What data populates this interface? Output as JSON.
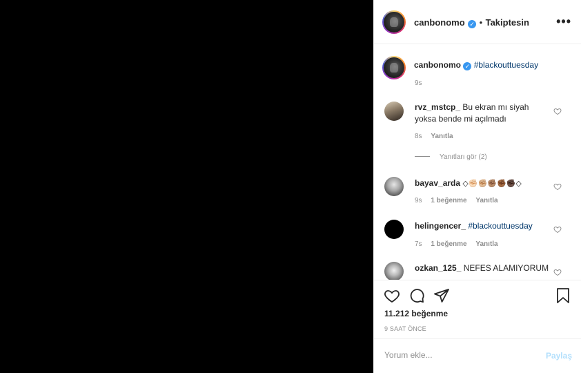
{
  "post": {
    "username": "canbonomo",
    "follow_separator": "•",
    "follow_label": "Takiptesin",
    "more_icon": "more-options-icon"
  },
  "caption": {
    "username": "canbonomo",
    "text": "#blackouttuesday",
    "time": "9s"
  },
  "comments": [
    {
      "username": "rvz_mstcp_",
      "text_line1": "Bu ekran mı siyah",
      "text_line2": "yoksa bende mi açılmadı",
      "time": "8s",
      "reply_label": "Yanıtla",
      "view_replies": "Yanıtları gör (2)"
    },
    {
      "username": "bayav_arda",
      "text": "◇✊🏻✊🏼✊🏽✊🏾✊🏿◇",
      "time": "9s",
      "likes": "1 beğenme",
      "reply_label": "Yanıtla"
    },
    {
      "username": "helingencer_",
      "text": "#blackouttuesday",
      "time": "7s",
      "likes": "1 beğenme",
      "reply_label": "Yanıtla"
    },
    {
      "username": "ozkan_125_",
      "text": "NEFES ALAMIYORUM"
    }
  ],
  "actions": {
    "like_count": "11.212 beğenme",
    "posted_ago": "9 SAAT ÖNCE"
  },
  "comment_form": {
    "placeholder": "Yorum ekle...",
    "submit_label": "Paylaş"
  },
  "colors": {
    "verified": "#3897f0",
    "hashtag": "#00376b",
    "muted": "#8e8e8e",
    "share_disabled": "#b2dffc"
  }
}
